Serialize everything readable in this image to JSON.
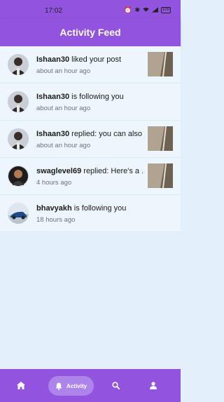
{
  "status_bar": {
    "time": "17:02",
    "icons": [
      "alarm-icon",
      "bluetooth-icon",
      "vibrate-icon",
      "wifi-icon",
      "signal-icon",
      "battery-icon"
    ],
    "battery": "100"
  },
  "header": {
    "title": "Activity Feed"
  },
  "feed": [
    {
      "user": "Ishaan30",
      "action": " liked your post",
      "time": "about an hour ago",
      "has_thumb": true
    },
    {
      "user": "Ishaan30",
      "action": " is following you",
      "time": "about an hour ago",
      "has_thumb": false
    },
    {
      "user": "Ishaan30",
      "action": " replied: you can also ...",
      "time": "about an hour ago",
      "has_thumb": true
    },
    {
      "user": "swaglevel69",
      "action": " replied: Here's a ...",
      "time": "4 hours ago",
      "has_thumb": true
    },
    {
      "user": "bhavyakh",
      "action": " is following you",
      "time": "18 hours ago",
      "has_thumb": false
    }
  ],
  "bottom_nav": {
    "active_label": "Activity",
    "items": [
      "home-icon",
      "bell-icon",
      "search-icon",
      "person-icon"
    ]
  },
  "colors": {
    "accent": "#9254de",
    "active_pill": "#ad84ea",
    "feed_bg": "#eef6fd",
    "page_bg": "#e3f0fb"
  }
}
